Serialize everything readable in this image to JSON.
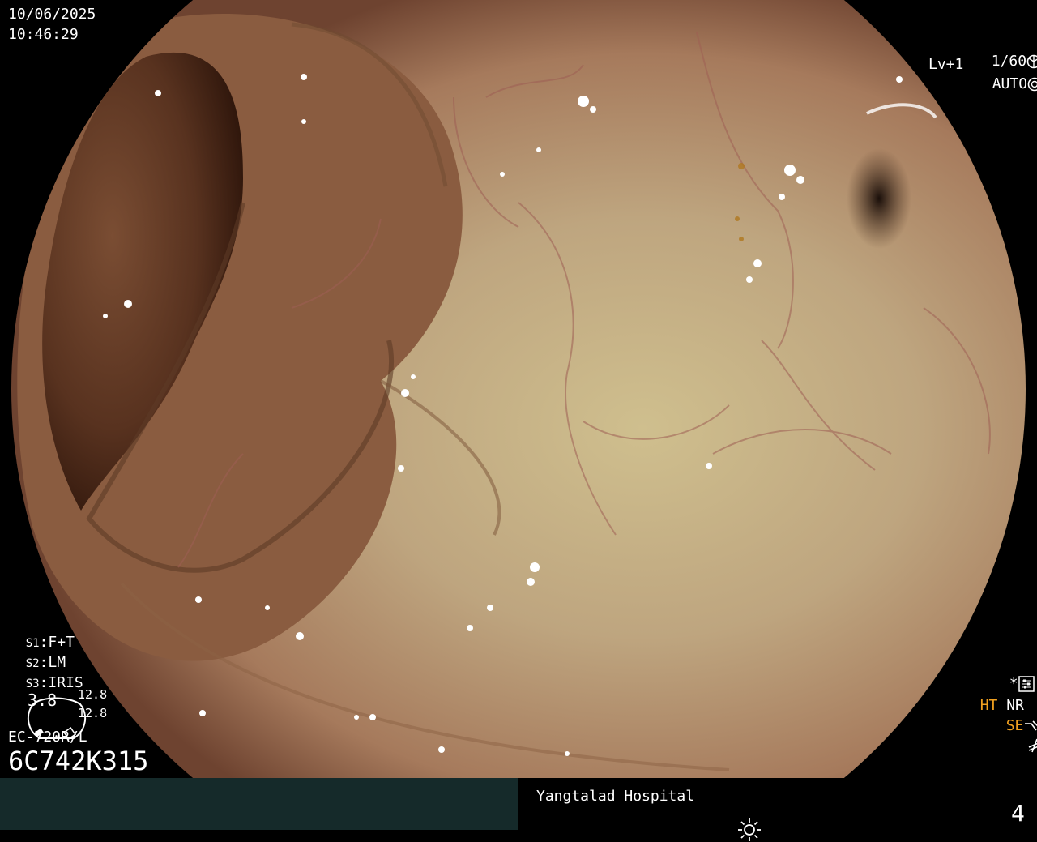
{
  "header": {
    "date": "10/06/2025",
    "time": "10:46:29"
  },
  "top_right": {
    "shutter": "1/60",
    "level": "Lv+1",
    "iris": "AUTO"
  },
  "left_panel": {
    "s1": {
      "key": "S1",
      "value": "F+T"
    },
    "s2": {
      "key": "S2",
      "value": "LM"
    },
    "s3": {
      "key": "S3",
      "value": "IRIS"
    },
    "gauge_value": "3.8",
    "gauge_top": "12.8",
    "gauge_bottom": "12.8",
    "scope_model": "EC-720R/L",
    "serial": "6C742K315"
  },
  "right_panel": {
    "star": "*",
    "ht": "HT",
    "nr": "NR",
    "se": "SE"
  },
  "footer": {
    "hospital": "Yangtalad Hospital",
    "image_count": "4"
  },
  "colors": {
    "accent_orange": "#f0a020",
    "footer_bar": "#152a2a",
    "tissue": "#bfa482",
    "lumen": "#3a1c10"
  },
  "icons": {
    "shutter": "shutter-aperture-icon",
    "iris": "iris-icon",
    "settings": "settings-sliders-icon",
    "se": "se-wave-icon",
    "freeze": "freeze-icon",
    "brightness": "brightness-sun-icon"
  }
}
